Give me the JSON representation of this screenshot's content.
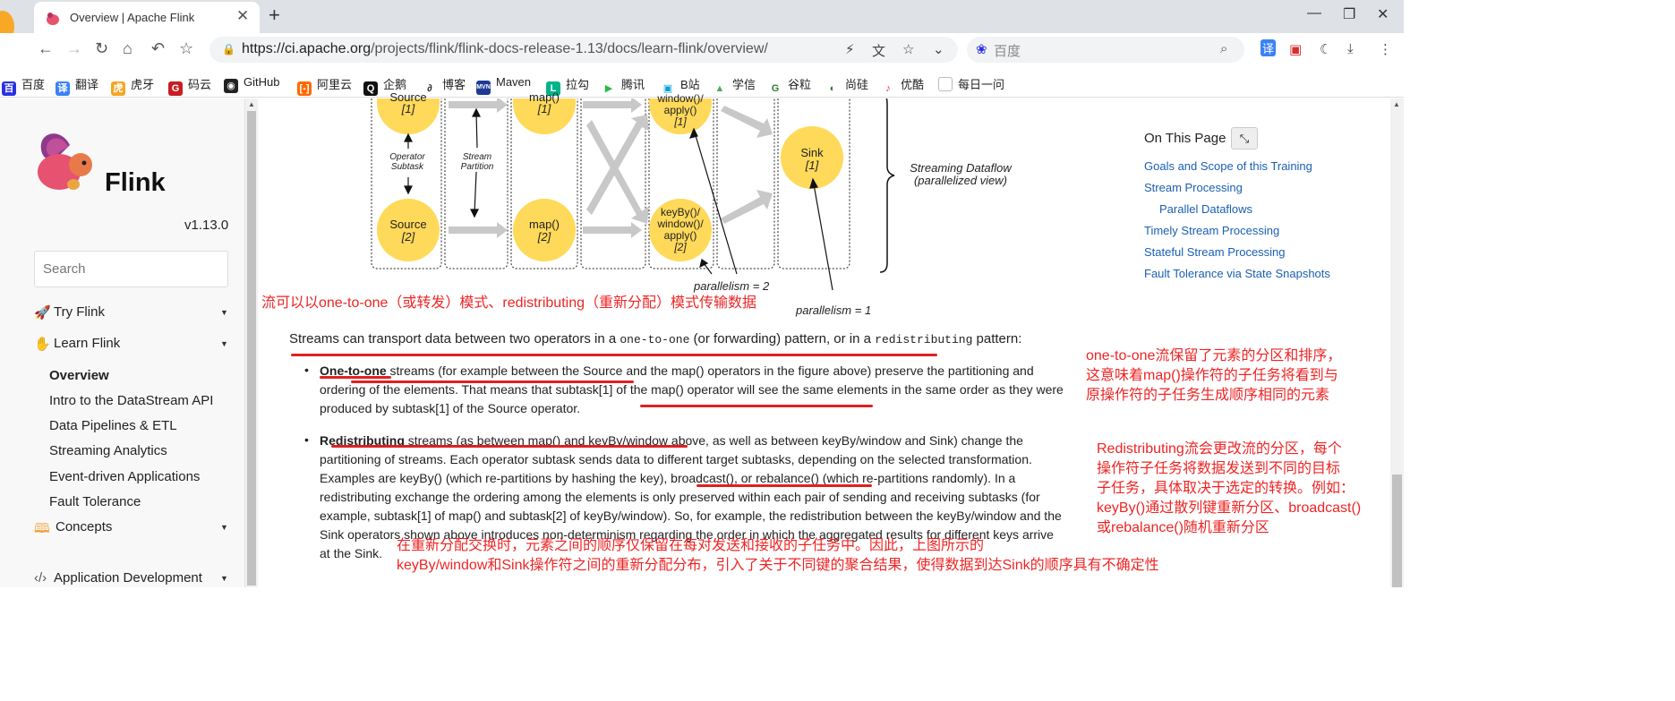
{
  "browser": {
    "tab_title": "Overview | Apache Flink",
    "url_prefix": "https://ci.apache.org",
    "url_rest": "/projects/flink/flink-docs-release-1.13/docs/learn-flink/overview/",
    "search_placeholder": "百度",
    "bookmarks": [
      "百度",
      "翻译",
      "虎牙",
      "码云",
      "GitHub",
      "阿里云",
      "企鹅",
      "博客",
      "Maven",
      "拉勾",
      "腾讯",
      "B站",
      "学信",
      "谷粒",
      "尚硅",
      "优酷",
      "每日一问"
    ]
  },
  "sidebar": {
    "logo_text": "Flink",
    "version": "v1.13.0",
    "search_placeholder": "Search",
    "sections": [
      {
        "label": "Try Flink",
        "icon": "rocket-icon"
      },
      {
        "label": "Learn Flink",
        "icon": "hand-icon"
      }
    ],
    "learn_items": [
      "Overview",
      "Intro to the DataStream API",
      "Data Pipelines & ETL",
      "Streaming Analytics",
      "Event-driven Applications",
      "Fault Tolerance"
    ],
    "more_sections": [
      {
        "label": "Concepts",
        "icon": "book-icon"
      },
      {
        "label": "Application Development",
        "icon": "code-icon"
      }
    ]
  },
  "diagram": {
    "nodes": {
      "source1": [
        "Source",
        "[1]"
      ],
      "map1": [
        "map()",
        "[1]"
      ],
      "key1": [
        "window()/",
        "apply()",
        "[1]"
      ],
      "source2": [
        "Source",
        "[2]"
      ],
      "map2": [
        "map()",
        "[2]"
      ],
      "key2": [
        "keyBy()/",
        "window()/",
        "apply()",
        "[2]"
      ],
      "sink": [
        "Sink",
        "[1]"
      ]
    },
    "operator_subtask": [
      "Operator",
      "Subtask"
    ],
    "stream_partition": [
      "Stream",
      "Partition"
    ],
    "streaming_dataflow": [
      "Streaming Dataflow",
      "(parallelized view)"
    ],
    "parallelism_2": "parallelism = 2",
    "parallelism_1": "parallelism = 1"
  },
  "article": {
    "intro_a": "Streams can transport data between two operators in a ",
    "intro_code1": "one-to-one",
    "intro_b": " (or forwarding) pattern, or in a ",
    "intro_code2": "redistributing",
    "intro_c": " pattern:",
    "b1_bold": "One-to-one",
    "b1_l1": " streams (for example between the Source and the map() operators in the figure above) preserve the partitioning and",
    "b1_l2": "ordering of the elements. That means that subtask[1] of the map() operator will see the same elements in the same order as they were",
    "b1_l3": "produced by subtask[1] of the Source operator.",
    "b2_bold": "Redistributing",
    "b2_l1": " streams (as between map() and keyBy/window above, as well as between keyBy/window and Sink) change the",
    "b2_l2": "partitioning of streams. Each operator subtask sends data to different target subtasks, depending on the selected transformation.",
    "b2_l3": "Examples are keyBy() (which re-partitions by hashing the key), broadcast(), or rebalance() (which re-partitions randomly). In a",
    "b2_l4": "redistributing exchange the ordering among the elements is only preserved within each pair of sending and receiving subtasks (for",
    "b2_l5": "example, subtask[1] of map() and subtask[2] of keyBy/window). So, for example, the redistribution between the keyBy/window and the",
    "b2_l6": "Sink operators shown above introduces non-determinism regarding the order in which the aggregated results for different keys arrive",
    "b2_l7": "at the Sink."
  },
  "toc": {
    "title": "On This Page",
    "items": [
      "Goals and Scope of this Training",
      "Stream Processing",
      "Parallel Dataflows",
      "Timely Stream Processing",
      "Stateful Stream Processing",
      "Fault Tolerance via State Snapshots"
    ]
  },
  "annotations": {
    "n1": "流可以以one-to-one（或转发）模式、redistributing（重新分配）模式传输数据",
    "n2": [
      "one-to-one流保留了元素的分区和排序，",
      "这意味着map()操作符的子任务将看到与",
      "原操作符的子任务生成顺序相同的元素"
    ],
    "n3": [
      "Redistributing流会更改流的分区，每个",
      "操作符子任务将数据发送到不同的目标",
      "子任务，具体取决于选定的转换。例如：",
      "keyBy()通过散列键重新分区、broadcast()",
      "或rebalance()随机重新分区"
    ],
    "n4": [
      "在重新分配交换时，元素之间的顺序仅保留在每对发送和接收的子任务中。因此，上图所示的",
      "keyBy/window和Sink操作符之间的重新分配分布，引入了关于不同键的聚合结果，使得数据到达Sink的顺序具有不确定性"
    ]
  },
  "colors": {
    "annotation": "#ee2525",
    "node_fill": "#ffd95a",
    "link": "#1a5fb4"
  }
}
